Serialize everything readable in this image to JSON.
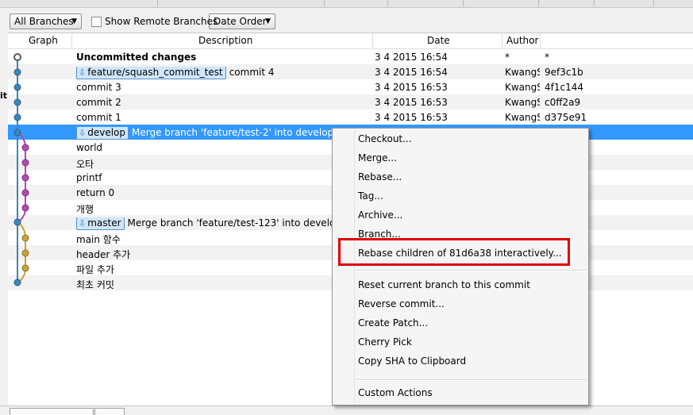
{
  "toolbar": {
    "branches_label": "All Branches",
    "show_remote_label": "Show Remote Branches",
    "order_label": "Date Order"
  },
  "left_partial_text": "it",
  "columns": [
    "Graph",
    "Description",
    "Date",
    "Author"
  ],
  "rows": [
    {
      "ref": "",
      "desc": "Uncommitted changes",
      "date": "3 4 2015 16:54",
      "author": "*",
      "sha": "*"
    },
    {
      "ref": "feature/squash_commit_test",
      "desc": "commit 4",
      "date": "3 4 2015 16:54",
      "author": "KwangS",
      "sha": "9ef3c1b"
    },
    {
      "ref": "",
      "desc": "commit 3",
      "date": "3 4 2015 16:53",
      "author": "KwangS",
      "sha": "4f1c144"
    },
    {
      "ref": "",
      "desc": "commit 2",
      "date": "3 4 2015 16:53",
      "author": "KwangS",
      "sha": "c0ff2a9"
    },
    {
      "ref": "",
      "desc": "commit 1",
      "date": "3 4 2015 16:53",
      "author": "KwangS",
      "sha": "d375e91"
    },
    {
      "ref": "develop",
      "desc": "Merge branch 'feature/test-2' into develop",
      "date": "",
      "author": "",
      "sha": ""
    },
    {
      "ref": "",
      "desc": "world",
      "date": "",
      "author": "",
      "sha": ""
    },
    {
      "ref": "",
      "desc": "오타",
      "date": "",
      "author": "",
      "sha": ""
    },
    {
      "ref": "",
      "desc": "printf",
      "date": "",
      "author": "",
      "sha": ""
    },
    {
      "ref": "",
      "desc": "return 0",
      "date": "",
      "author": "",
      "sha": ""
    },
    {
      "ref": "",
      "desc": "개행",
      "date": "",
      "author": "",
      "sha": ""
    },
    {
      "ref": "master",
      "desc": "Merge branch 'feature/test-123' into develop",
      "date": "",
      "author": "",
      "sha": ""
    },
    {
      "ref": "",
      "desc": "main 함수",
      "date": "",
      "author": "",
      "sha": ""
    },
    {
      "ref": "",
      "desc": "header 추가",
      "date": "",
      "author": "",
      "sha": ""
    },
    {
      "ref": "",
      "desc": "파일 추가",
      "date": "",
      "author": "",
      "sha": ""
    },
    {
      "ref": "",
      "desc": "최초 커밋",
      "date": "",
      "author": "",
      "sha": ""
    }
  ],
  "context_menu": {
    "checkout": "Checkout...",
    "merge": "Merge...",
    "rebase": "Rebase...",
    "tag": "Tag...",
    "archive": "Archive...",
    "branch": "Branch...",
    "rebase_children": "Rebase children of 81d6a38 interactively...",
    "reset": "Reset current branch to this commit",
    "reverse": "Reverse commit...",
    "create_patch": "Create Patch...",
    "cherry_pick": "Cherry Pick",
    "copy_sha": "Copy SHA to Clipboard",
    "custom_actions": "Custom Actions"
  },
  "colors": {
    "selection": "#3399ff",
    "branch_main": "#3d86b8",
    "branch_feature": "#b449b4",
    "branch_old": "#c8a23c",
    "highlight_box": "#e00000",
    "ref_tag_fill": "#cfe6fb"
  },
  "icons": {
    "ref_tag": "tag-merge-icon",
    "combo_arrow": "triangle-down"
  }
}
